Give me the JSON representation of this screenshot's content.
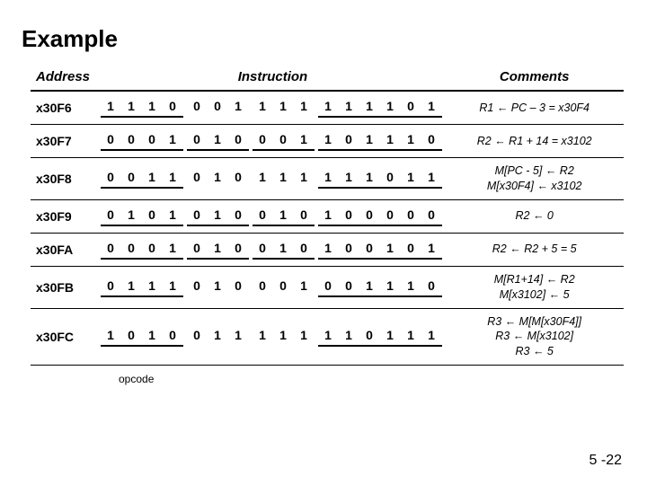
{
  "title": "Example",
  "headers": {
    "address": "Address",
    "instruction": "Instruction",
    "comments": "Comments"
  },
  "opcode_label": "opcode",
  "page_number": "5 -22",
  "rows": [
    {
      "address": "x30F6",
      "bits": [
        "1",
        "1",
        "1",
        "0",
        "0",
        "0",
        "1",
        "1",
        "1",
        "1",
        "1",
        "1",
        "1",
        "1",
        "0",
        "1"
      ],
      "underline": [
        1,
        0,
        0,
        1
      ],
      "comment_lines": [
        "R1 ← PC – 3 = x30F4"
      ]
    },
    {
      "address": "x30F7",
      "bits": [
        "0",
        "0",
        "0",
        "1",
        "0",
        "1",
        "0",
        "0",
        "0",
        "1",
        "1",
        "0",
        "1",
        "1",
        "1",
        "0"
      ],
      "underline": [
        1,
        1,
        1,
        1
      ],
      "comment_lines": [
        "R2 ← R1 + 14 = x3102"
      ]
    },
    {
      "address": "x30F8",
      "bits": [
        "0",
        "0",
        "1",
        "1",
        "0",
        "1",
        "0",
        "1",
        "1",
        "1",
        "1",
        "1",
        "1",
        "0",
        "1",
        "1"
      ],
      "underline": [
        1,
        0,
        0,
        1
      ],
      "comment_lines": [
        "M[PC - 5] ← R2",
        "M[x30F4] ← x3102"
      ]
    },
    {
      "address": "x30F9",
      "bits": [
        "0",
        "1",
        "0",
        "1",
        "0",
        "1",
        "0",
        "0",
        "1",
        "0",
        "1",
        "0",
        "0",
        "0",
        "0",
        "0"
      ],
      "underline": [
        1,
        1,
        1,
        1
      ],
      "comment_lines": [
        "R2 ← 0"
      ]
    },
    {
      "address": "x30FA",
      "bits": [
        "0",
        "0",
        "0",
        "1",
        "0",
        "1",
        "0",
        "0",
        "1",
        "0",
        "1",
        "0",
        "0",
        "1",
        "0",
        "1"
      ],
      "underline": [
        1,
        1,
        1,
        1
      ],
      "comment_lines": [
        "R2 ← R2 + 5 = 5"
      ]
    },
    {
      "address": "x30FB",
      "bits": [
        "0",
        "1",
        "1",
        "1",
        "0",
        "1",
        "0",
        "0",
        "0",
        "1",
        "0",
        "0",
        "1",
        "1",
        "1",
        "0"
      ],
      "underline": [
        1,
        0,
        0,
        1
      ],
      "comment_lines": [
        "M[R1+14] ← R2",
        "M[x3102] ← 5"
      ]
    },
    {
      "address": "x30FC",
      "bits": [
        "1",
        "0",
        "1",
        "0",
        "0",
        "1",
        "1",
        "1",
        "1",
        "1",
        "1",
        "1",
        "0",
        "1",
        "1",
        "1"
      ],
      "underline": [
        1,
        0,
        0,
        1
      ],
      "comment_lines": [
        "R3 ← M[M[x30F4]]",
        "R3 ← M[x3102]",
        "R3 ← 5"
      ]
    }
  ]
}
